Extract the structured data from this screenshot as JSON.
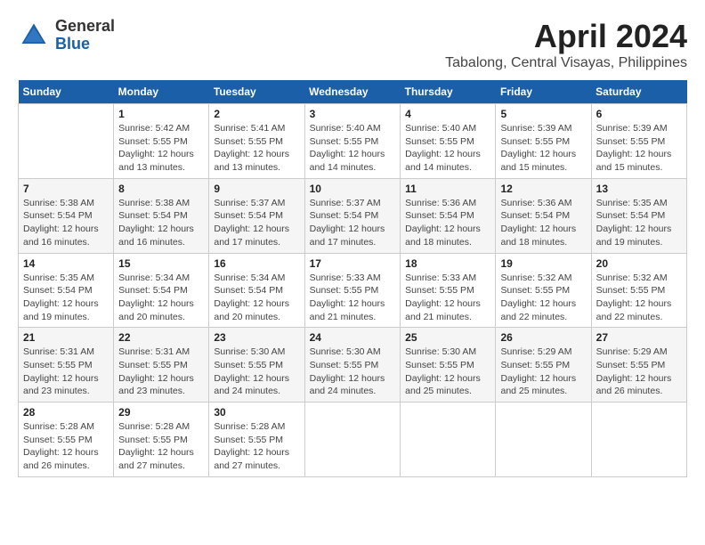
{
  "header": {
    "logo_general": "General",
    "logo_blue": "Blue",
    "month": "April 2024",
    "location": "Tabalong, Central Visayas, Philippines"
  },
  "weekdays": [
    "Sunday",
    "Monday",
    "Tuesday",
    "Wednesday",
    "Thursday",
    "Friday",
    "Saturday"
  ],
  "weeks": [
    [
      {
        "day": "",
        "info": ""
      },
      {
        "day": "1",
        "info": "Sunrise: 5:42 AM\nSunset: 5:55 PM\nDaylight: 12 hours\nand 13 minutes."
      },
      {
        "day": "2",
        "info": "Sunrise: 5:41 AM\nSunset: 5:55 PM\nDaylight: 12 hours\nand 13 minutes."
      },
      {
        "day": "3",
        "info": "Sunrise: 5:40 AM\nSunset: 5:55 PM\nDaylight: 12 hours\nand 14 minutes."
      },
      {
        "day": "4",
        "info": "Sunrise: 5:40 AM\nSunset: 5:55 PM\nDaylight: 12 hours\nand 14 minutes."
      },
      {
        "day": "5",
        "info": "Sunrise: 5:39 AM\nSunset: 5:55 PM\nDaylight: 12 hours\nand 15 minutes."
      },
      {
        "day": "6",
        "info": "Sunrise: 5:39 AM\nSunset: 5:55 PM\nDaylight: 12 hours\nand 15 minutes."
      }
    ],
    [
      {
        "day": "7",
        "info": "Sunrise: 5:38 AM\nSunset: 5:54 PM\nDaylight: 12 hours\nand 16 minutes."
      },
      {
        "day": "8",
        "info": "Sunrise: 5:38 AM\nSunset: 5:54 PM\nDaylight: 12 hours\nand 16 minutes."
      },
      {
        "day": "9",
        "info": "Sunrise: 5:37 AM\nSunset: 5:54 PM\nDaylight: 12 hours\nand 17 minutes."
      },
      {
        "day": "10",
        "info": "Sunrise: 5:37 AM\nSunset: 5:54 PM\nDaylight: 12 hours\nand 17 minutes."
      },
      {
        "day": "11",
        "info": "Sunrise: 5:36 AM\nSunset: 5:54 PM\nDaylight: 12 hours\nand 18 minutes."
      },
      {
        "day": "12",
        "info": "Sunrise: 5:36 AM\nSunset: 5:54 PM\nDaylight: 12 hours\nand 18 minutes."
      },
      {
        "day": "13",
        "info": "Sunrise: 5:35 AM\nSunset: 5:54 PM\nDaylight: 12 hours\nand 19 minutes."
      }
    ],
    [
      {
        "day": "14",
        "info": "Sunrise: 5:35 AM\nSunset: 5:54 PM\nDaylight: 12 hours\nand 19 minutes."
      },
      {
        "day": "15",
        "info": "Sunrise: 5:34 AM\nSunset: 5:54 PM\nDaylight: 12 hours\nand 20 minutes."
      },
      {
        "day": "16",
        "info": "Sunrise: 5:34 AM\nSunset: 5:54 PM\nDaylight: 12 hours\nand 20 minutes."
      },
      {
        "day": "17",
        "info": "Sunrise: 5:33 AM\nSunset: 5:55 PM\nDaylight: 12 hours\nand 21 minutes."
      },
      {
        "day": "18",
        "info": "Sunrise: 5:33 AM\nSunset: 5:55 PM\nDaylight: 12 hours\nand 21 minutes."
      },
      {
        "day": "19",
        "info": "Sunrise: 5:32 AM\nSunset: 5:55 PM\nDaylight: 12 hours\nand 22 minutes."
      },
      {
        "day": "20",
        "info": "Sunrise: 5:32 AM\nSunset: 5:55 PM\nDaylight: 12 hours\nand 22 minutes."
      }
    ],
    [
      {
        "day": "21",
        "info": "Sunrise: 5:31 AM\nSunset: 5:55 PM\nDaylight: 12 hours\nand 23 minutes."
      },
      {
        "day": "22",
        "info": "Sunrise: 5:31 AM\nSunset: 5:55 PM\nDaylight: 12 hours\nand 23 minutes."
      },
      {
        "day": "23",
        "info": "Sunrise: 5:30 AM\nSunset: 5:55 PM\nDaylight: 12 hours\nand 24 minutes."
      },
      {
        "day": "24",
        "info": "Sunrise: 5:30 AM\nSunset: 5:55 PM\nDaylight: 12 hours\nand 24 minutes."
      },
      {
        "day": "25",
        "info": "Sunrise: 5:30 AM\nSunset: 5:55 PM\nDaylight: 12 hours\nand 25 minutes."
      },
      {
        "day": "26",
        "info": "Sunrise: 5:29 AM\nSunset: 5:55 PM\nDaylight: 12 hours\nand 25 minutes."
      },
      {
        "day": "27",
        "info": "Sunrise: 5:29 AM\nSunset: 5:55 PM\nDaylight: 12 hours\nand 26 minutes."
      }
    ],
    [
      {
        "day": "28",
        "info": "Sunrise: 5:28 AM\nSunset: 5:55 PM\nDaylight: 12 hours\nand 26 minutes."
      },
      {
        "day": "29",
        "info": "Sunrise: 5:28 AM\nSunset: 5:55 PM\nDaylight: 12 hours\nand 27 minutes."
      },
      {
        "day": "30",
        "info": "Sunrise: 5:28 AM\nSunset: 5:55 PM\nDaylight: 12 hours\nand 27 minutes."
      },
      {
        "day": "",
        "info": ""
      },
      {
        "day": "",
        "info": ""
      },
      {
        "day": "",
        "info": ""
      },
      {
        "day": "",
        "info": ""
      }
    ]
  ]
}
